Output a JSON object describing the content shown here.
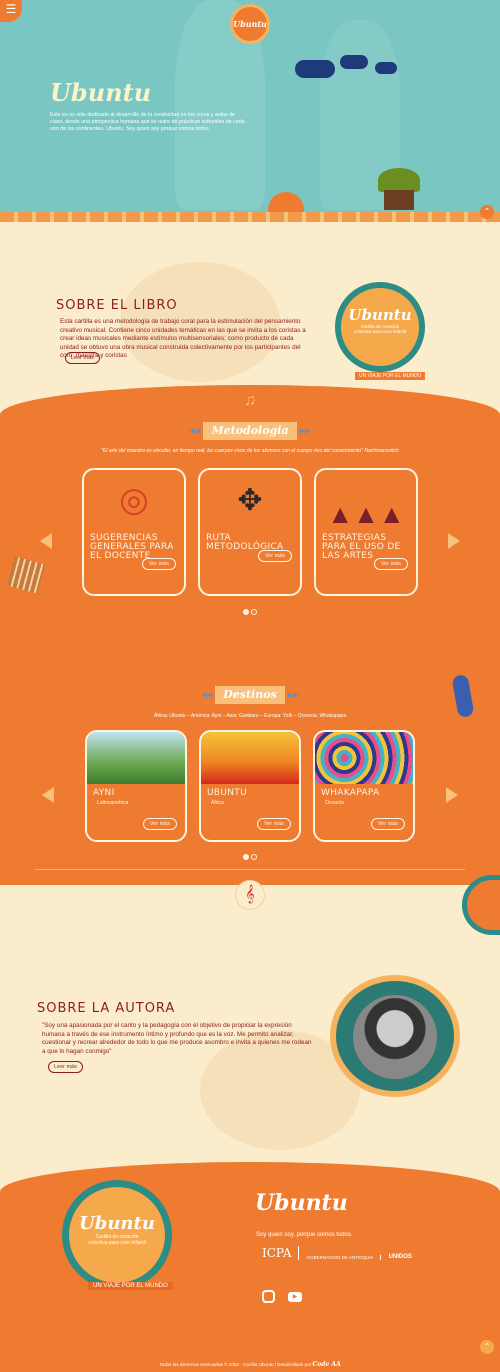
{
  "hero": {
    "title": "Ubuntu",
    "text": "Este es un sitio dedicado al desarrollo de la creatividad en los coros y aulas de clase, desde una perspectiva humana que se nutre de prácticas culturales de cada uno de los continentes. Ubuntu. Soy quien soy porque somos todos",
    "logo": "Ubuntu"
  },
  "libro": {
    "title": "SOBRE EL LIBRO",
    "text": "Esta cartilla es una metodología de trabajo coral para la estimulación del pensamiento creativo musical. Contiene cinco unidades temáticas en las que se invita a los coristas a crear ideas musicales mediante estímulos multisensoriales; como producto de cada unidad se obtuvo una obra musical construida colectivamente por los participantes del coro: maestra y coristas",
    "button": "Leer más",
    "logo_title": "Ubuntu",
    "logo_sub": "Cartilla de creación colectiva para coro infantil",
    "logo_ribbon": "UN VIAJE POR EL MUNDO"
  },
  "metodologia": {
    "title": "Metodologia",
    "quote": "\"El arte del maestro es vincular, en tiempo real, los cuerpos vivos de los alumnos con el cuerpo vivo del conocimiento\" Nachmanovitch",
    "cards": [
      {
        "title": "SUGERENCIAS GENERALES PARA EL DOCENTE",
        "button": "Ver más"
      },
      {
        "title": "RUTA METODOLÓGICA",
        "button": "Ver más"
      },
      {
        "title": "ESTRATEGIAS PARA EL USO DE LAS ARTES",
        "button": "Ver más"
      }
    ]
  },
  "destinos": {
    "title": "Destinos",
    "subtitle": "África: Ubuntu – América: Ayni – Asia: Ganbaru – Europa: Yolk – Oceanía: Whakapapa",
    "cards": [
      {
        "title": "AYNI",
        "region": "Latinoamérica",
        "button": "Ver más"
      },
      {
        "title": "UBUNTU",
        "region": "África",
        "button": "Ver más"
      },
      {
        "title": "WHAKAPAPA",
        "region": "Oceanía",
        "button": "Ver más"
      }
    ]
  },
  "autora": {
    "title": "SOBRE LA AUTORA",
    "text": "\"Soy una apasionada por el canto y la pedagogía con el objetivo de propiciar la expresión humana a través de ese instrumento íntimo y profundo que es la voz. Me permito analizar, cuestionar y recrear alrededor de todo lo que me produce asombro e invita a quienes me rodean a que lo hagan conmigo\"",
    "button": "Leer más"
  },
  "footer": {
    "title": "Ubuntu",
    "tagline": "Soy quien soy, porque somos todos.",
    "partners": [
      "ICPA",
      "GOBERNACIÓN DE ANTIOQUIA",
      "UNIDOS"
    ],
    "copyright": "Todos los derechos reservados © 2022 - Cartilla Ubuntu / Desarrollado por",
    "dev": "Code AA"
  },
  "colors": {
    "teal": "#79c6c3",
    "orange": "#ee7b30",
    "cream": "#fbeccb",
    "red": "#8b1f1f"
  }
}
